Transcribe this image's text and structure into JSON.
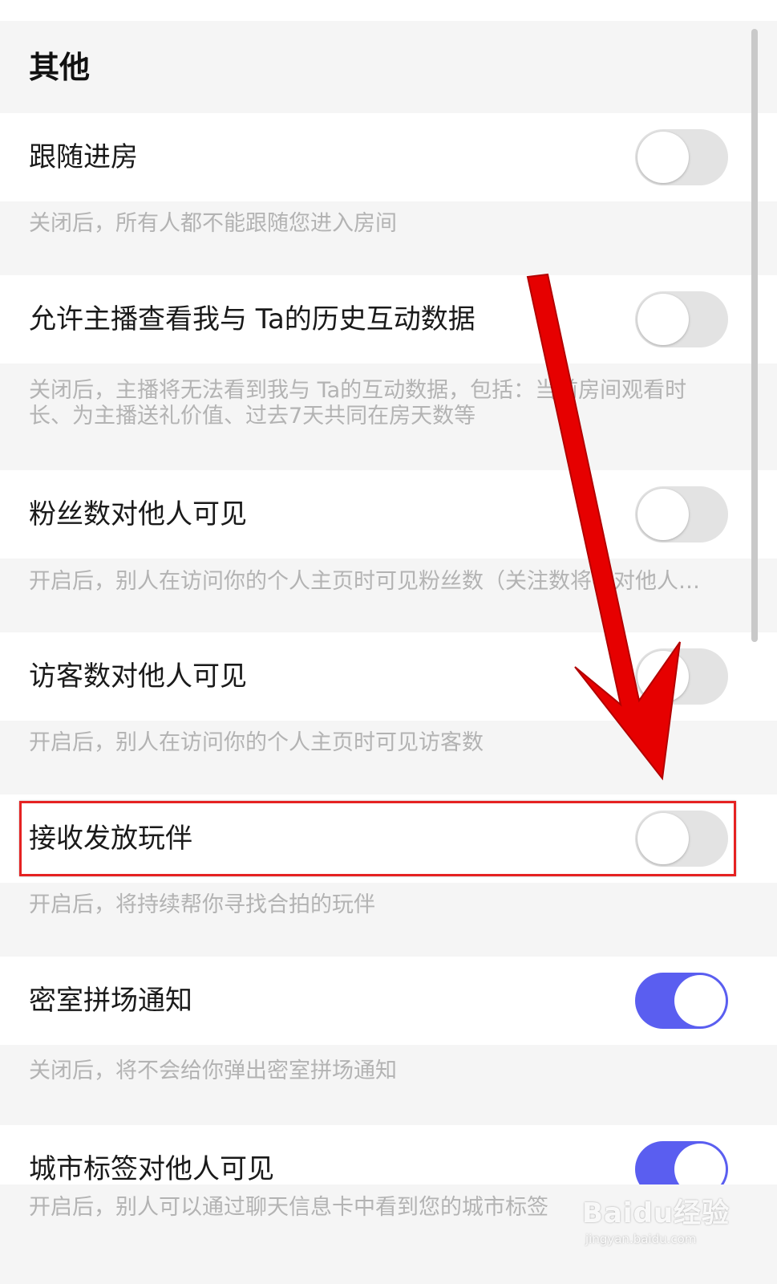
{
  "section": {
    "title": "其他"
  },
  "settings": [
    {
      "label": "跟随进房",
      "on": false,
      "description": "关闭后，所有人都不能跟随您进入房间"
    },
    {
      "label": "允许主播查看我与 Ta的历史互动数据",
      "on": false,
      "description": "关闭后，主播将无法看到我与 Ta的互动数据，包括：当前房间观看时长、为主播送礼价值、过去7天共同在房天数等"
    },
    {
      "label": "粉丝数对他人可见",
      "on": false,
      "description": "开启后，别人在访问你的个人主页时可见粉丝数（关注数将不对他人…"
    },
    {
      "label": "访客数对他人可见",
      "on": false,
      "description": "开启后，别人在访问你的个人主页时可见访客数"
    },
    {
      "label": "接收发放玩伴",
      "on": false,
      "description": "开启后，将持续帮你寻找合拍的玩伴"
    },
    {
      "label": "密室拼场通知",
      "on": true,
      "description": "关闭后，将不会给你弹出密室拼场通知"
    },
    {
      "label": "城市标签对他人可见",
      "on": true,
      "description": "开启后，别人可以通过聊天信息卡中看到您的城市标签"
    }
  ],
  "watermark": {
    "logo": "Baidu经验",
    "url": "jingyan.baidu.com"
  },
  "colors": {
    "toggle_on": "#5a5ef0",
    "toggle_off": "#e3e3e3",
    "highlight": "#e52222",
    "arrow": "#e60000"
  }
}
